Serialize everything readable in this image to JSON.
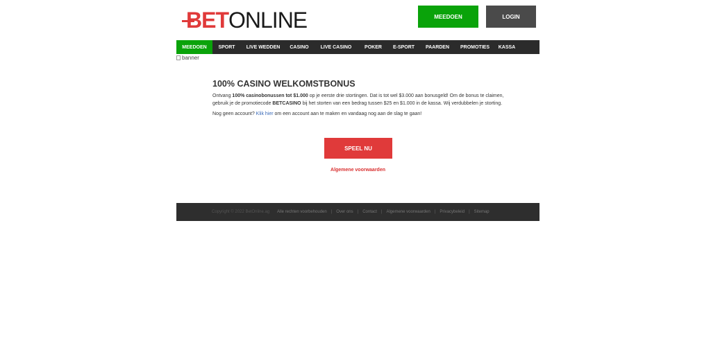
{
  "brand": {
    "bet": "BET",
    "online": "ONLINE"
  },
  "header": {
    "join_label": "MEEDOEN",
    "login_label": "LOGIN"
  },
  "nav": [
    {
      "label": "MEEDOEN",
      "active": true
    },
    {
      "label": "SPORT"
    },
    {
      "label": "LIVE WEDDEN"
    },
    {
      "label": "CASINO"
    },
    {
      "label": "LIVE CASINO"
    },
    {
      "label": "POKER"
    },
    {
      "label": "E-SPORT"
    },
    {
      "label": "PAARDEN"
    },
    {
      "label": "PROMOTIES"
    },
    {
      "label": "KASSA"
    }
  ],
  "banner": {
    "alt": "banner"
  },
  "promo": {
    "title": "100% CASINO WELKOMSTBONUS",
    "p1_a": "Ontvang ",
    "p1_b": "100% casinobonussen tot $1.000",
    "p1_c": " op je eerste drie stortingen. Dat is tot wel $3.000 aan bonusgeld! Om de bonus te claimen, gebruik je de promotiecode ",
    "p1_d": "BETCASINO",
    "p1_e": " bij het storten van een bedrag tussen $25 en $1.000 in de kassa. Wij verdubbelen je storting.",
    "p2_a": "Nog geen account? ",
    "p2_link": "Klik hier",
    "p2_b": " om een account aan te maken en vandaag nog aan de slag te gaan!",
    "play_label": "SPEEL NU",
    "terms_label": "Algemene voorwaarden"
  },
  "footer": {
    "copyright": "Copyright © 2022 BetOnline.ag",
    "links": [
      "Alle rechten voorbehouden",
      "Over ons",
      "Contact",
      "Algemene voorwaarden",
      "Privacybeleid",
      "Sitemap"
    ]
  },
  "colors": {
    "brand_red": "#e03a3a",
    "green": "#0aa30a",
    "dark": "#2b2b2b"
  }
}
